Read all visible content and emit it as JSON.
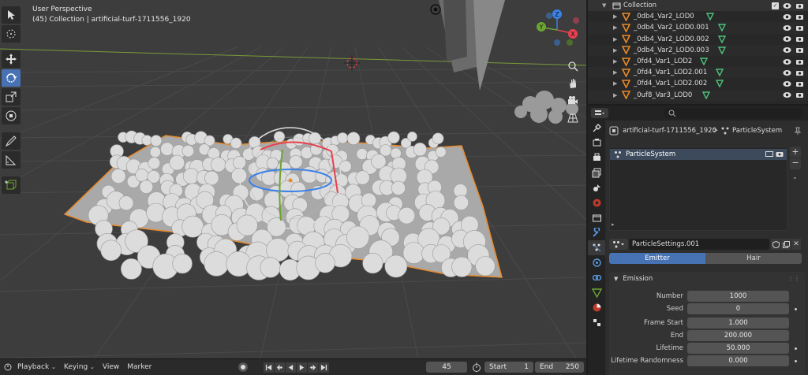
{
  "viewport": {
    "title": "User Perspective",
    "subtitle": "(45) Collection | artificial-turf-1711556_1920",
    "gizmo_axes": {
      "x": "X",
      "y": "Y",
      "z": "Z"
    },
    "colors": {
      "x": "#e8414f",
      "y": "#6ca532",
      "z": "#3b82e8",
      "selection": "#e88a2a"
    }
  },
  "timeline": {
    "menus": [
      "Playback",
      "Keying",
      "View",
      "Marker"
    ],
    "current_frame": "45",
    "start_label": "Start",
    "start_value": "1",
    "end_label": "End",
    "end_value": "250"
  },
  "outliner": {
    "collection": "Collection",
    "items": [
      "_0db4_Var2_LOD0",
      "_0db4_Var2_LOD0.001",
      "_0db4_Var2_LOD0.002",
      "_0db4_Var2_LOD0.003",
      "_0fd4_Var1_LOD2",
      "_0fd4_Var1_LOD2.001",
      "_0fd4_Var1_LOD2.002",
      "_0uf8_Var3_LOD0"
    ]
  },
  "properties": {
    "breadcrumb_object": "artificial-turf-1711556_1920",
    "breadcrumb_separator": ">",
    "breadcrumb_system": "ParticleSystem",
    "system_list_item": "ParticleSystem",
    "settings_name": "ParticleSettings.001",
    "tabs": {
      "emitter": "Emitter",
      "hair": "Hair"
    },
    "emission": {
      "header": "Emission",
      "fields": [
        {
          "label": "Number",
          "value": "1000"
        },
        {
          "label": "Seed",
          "value": "0"
        },
        {
          "label": "Frame Start",
          "value": "1.000"
        },
        {
          "label": "End",
          "value": "200.000"
        },
        {
          "label": "Lifetime",
          "value": "50.000"
        },
        {
          "label": "Lifetime Randomness",
          "value": "0.000"
        }
      ]
    },
    "accent_color": "#4772b3"
  }
}
